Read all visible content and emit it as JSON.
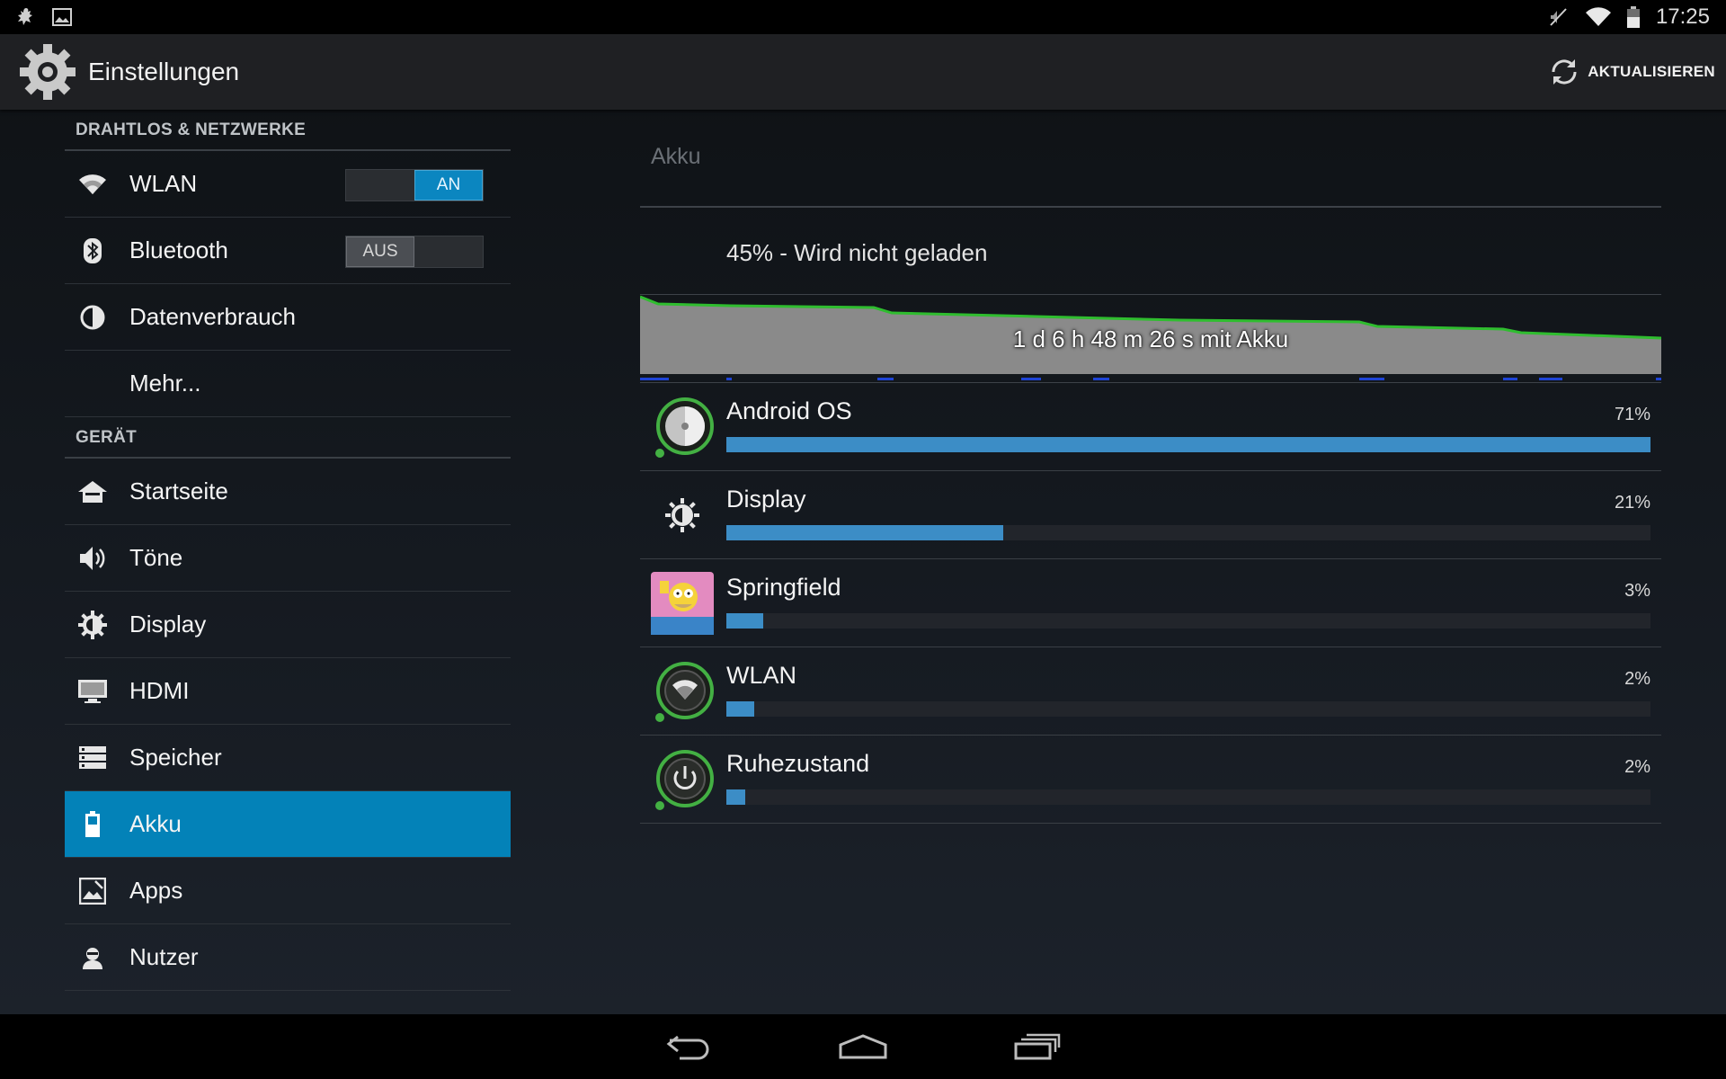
{
  "status_bar": {
    "time": "17:25",
    "left_icons": [
      "notification-app-icon",
      "gallery-notification-icon"
    ],
    "right_icons": [
      "muted-icon",
      "wifi-signal-icon",
      "battery-icon"
    ]
  },
  "action_bar": {
    "title": "Einstellungen",
    "refresh_label": "AKTUALISIEREN"
  },
  "sidebar": {
    "sections": [
      {
        "header": "DRAHTLOS & NETZWERKE",
        "items": [
          {
            "label": "WLAN",
            "icon": "wifi-icon",
            "toggle": "AN",
            "toggle_state": "on"
          },
          {
            "label": "Bluetooth",
            "icon": "bluetooth-icon",
            "toggle": "AUS",
            "toggle_state": "off"
          },
          {
            "label": "Datenverbrauch",
            "icon": "data-usage-icon"
          },
          {
            "label": "Mehr..."
          }
        ]
      },
      {
        "header": "GERÄT",
        "items": [
          {
            "label": "Startseite",
            "icon": "home-icon"
          },
          {
            "label": "Töne",
            "icon": "sound-icon"
          },
          {
            "label": "Display",
            "icon": "brightness-icon"
          },
          {
            "label": "HDMI",
            "icon": "monitor-icon"
          },
          {
            "label": "Speicher",
            "icon": "storage-icon"
          },
          {
            "label": "Akku",
            "icon": "battery-icon",
            "selected": true
          },
          {
            "label": "Apps",
            "icon": "apps-icon"
          },
          {
            "label": "Nutzer",
            "icon": "user-icon"
          }
        ]
      }
    ]
  },
  "battery": {
    "title": "Akku",
    "status": "45% - Wird nicht geladen",
    "graph_label": "1 d 6 h 48 m 26 s mit Akku",
    "level_percent": 45,
    "colors": {
      "accent": "#3c8dc6",
      "selected": "#0382b8",
      "graph_line": "#2fbd2f",
      "graph_fill": "#8a8a8a"
    },
    "usage": [
      {
        "name": "Android OS",
        "percent_label": "71%",
        "fraction": 1.0,
        "icon": "android-os-icon"
      },
      {
        "name": "Display",
        "percent_label": "21%",
        "fraction": 0.3,
        "icon": "brightness-icon"
      },
      {
        "name": "Springfield",
        "percent_label": "3%",
        "fraction": 0.04,
        "icon": "springfield-app-icon"
      },
      {
        "name": "WLAN",
        "percent_label": "2%",
        "fraction": 0.03,
        "icon": "wifi-usage-icon"
      },
      {
        "name": "Ruhezustand",
        "percent_label": "2%",
        "fraction": 0.02,
        "icon": "standby-icon"
      }
    ]
  },
  "nav_bar": {
    "buttons": [
      "back-icon",
      "home-icon",
      "recent-apps-icon"
    ]
  }
}
